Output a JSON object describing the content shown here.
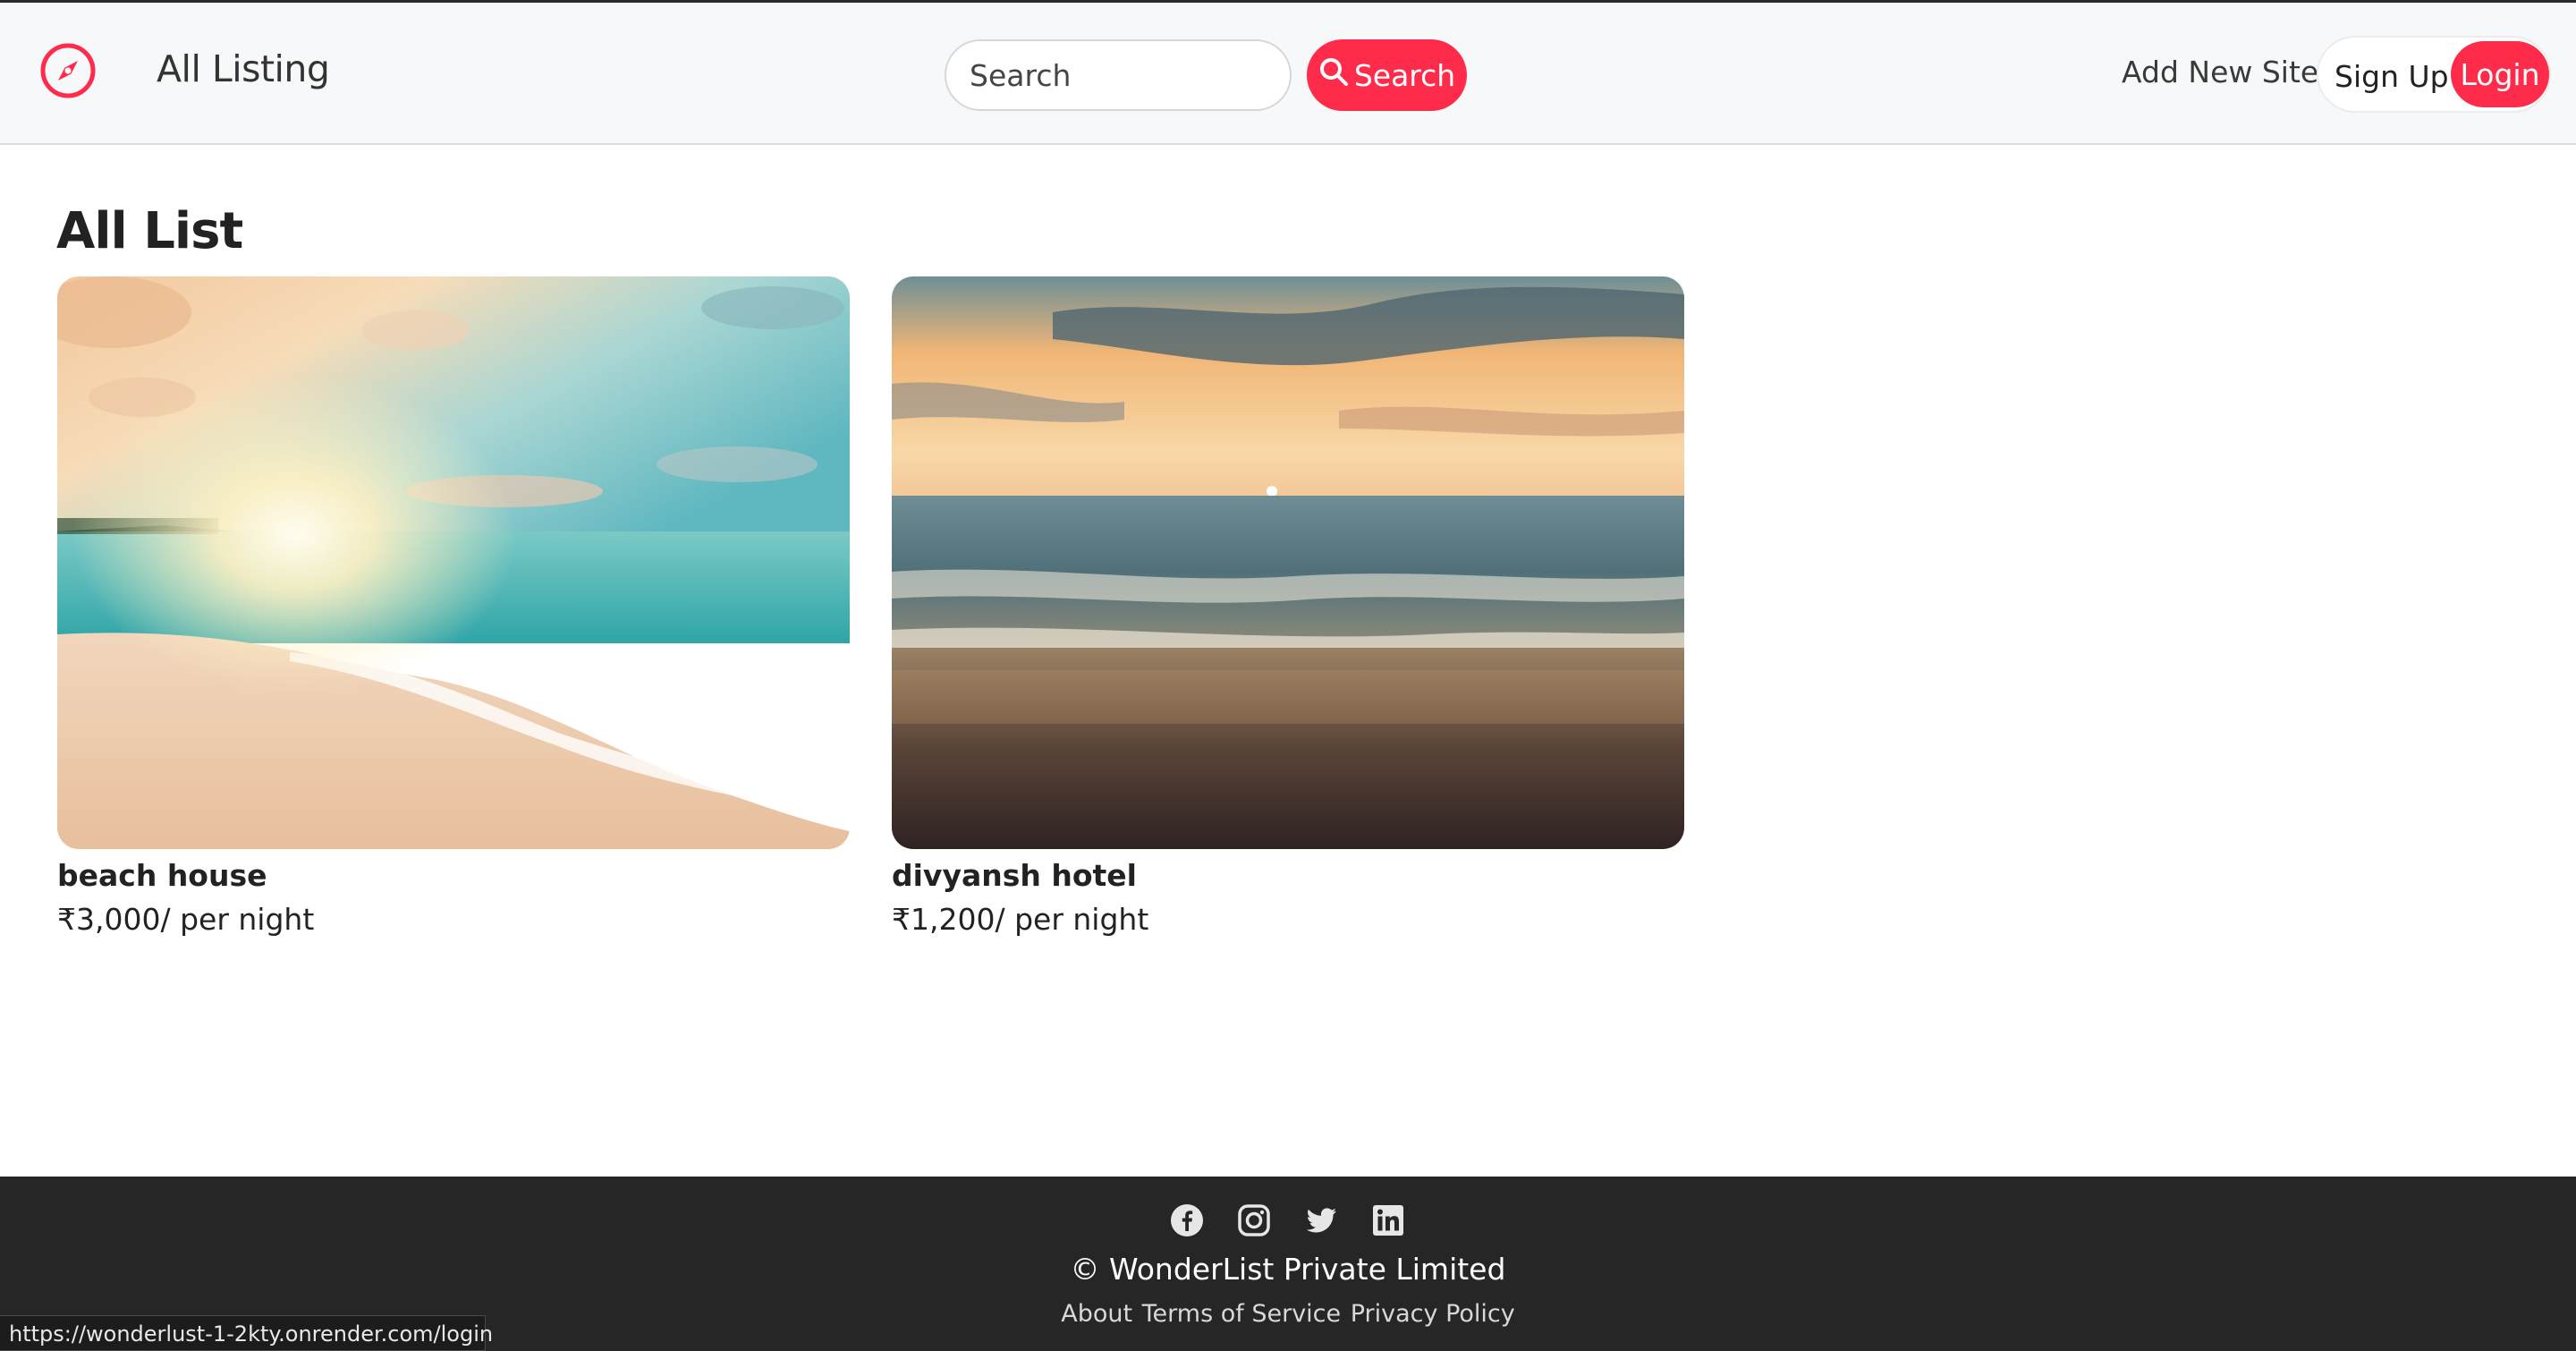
{
  "navbar": {
    "brand_icon": "compass-icon",
    "brand_label": "All Listing",
    "search_placeholder": "Search",
    "search_button_label": "Search",
    "search_button_icon": "magnifier-icon",
    "add_site_label": "Add New Site",
    "signup_label": "Sign Up",
    "login_label": "Login"
  },
  "main": {
    "title": "All List",
    "listings": [
      {
        "name": "beach house",
        "price": "₹3,000",
        "price_suffix": "/ per night",
        "image": "sunny-beach-photo"
      },
      {
        "name": "divyansh hotel",
        "price": "₹1,200",
        "price_suffix": "/ per night",
        "image": "sunset-beach-photo"
      }
    ]
  },
  "footer": {
    "social_icons": [
      "facebook-icon",
      "instagram-icon",
      "twitter-icon",
      "linkedin-icon"
    ],
    "copyright": "© WonderList Private Limited",
    "links": [
      "About",
      "Terms of Service",
      "Privacy Policy"
    ]
  },
  "status_bar": {
    "url": "https://wonderlust-1-2kty.onrender.com/login"
  },
  "colors": {
    "accent": "#fe2c4a",
    "navbar_bg": "#f7f8f9",
    "footer_bg": "#262626"
  }
}
